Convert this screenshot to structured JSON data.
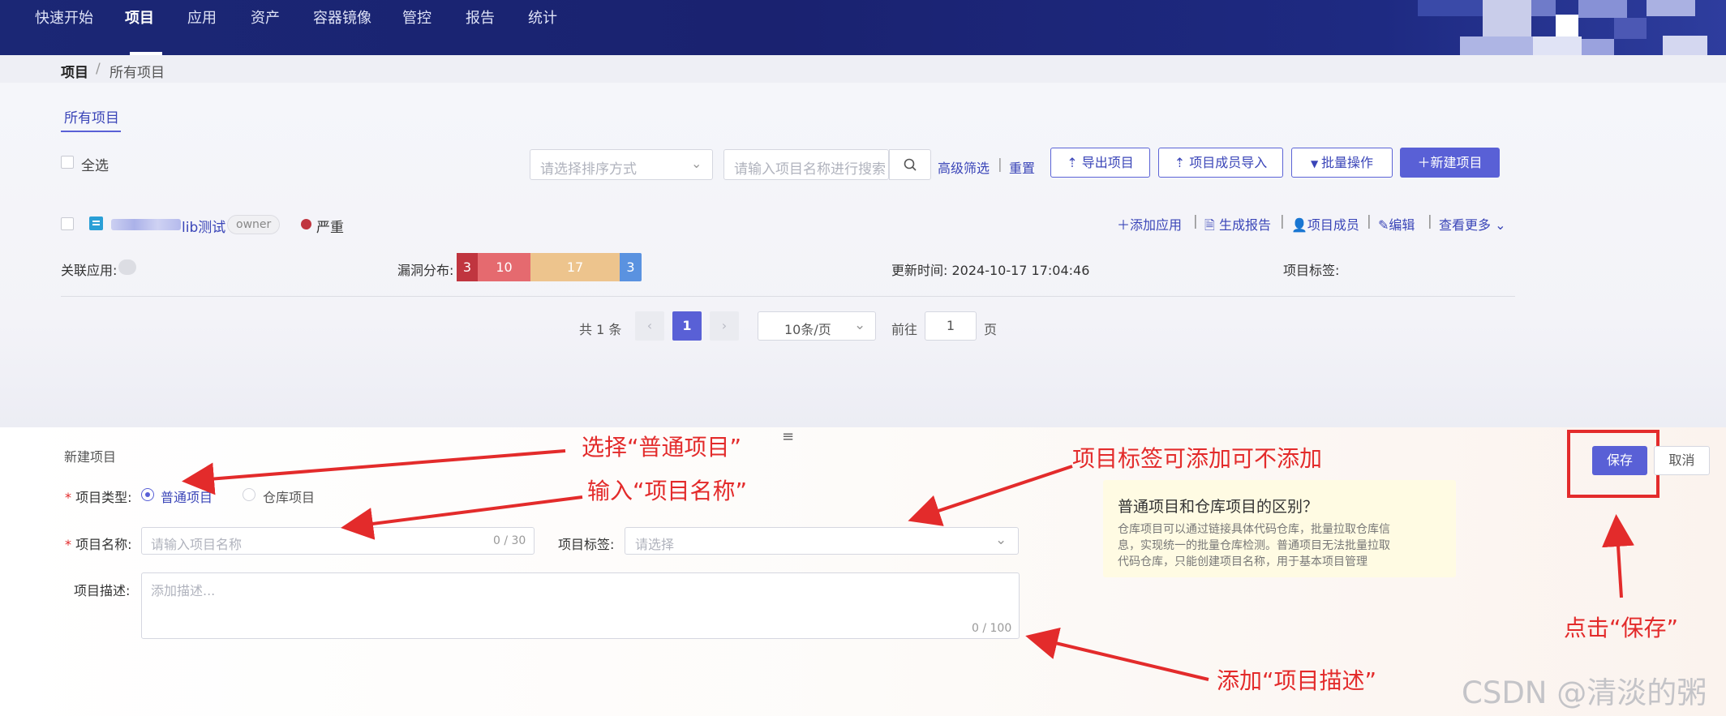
{
  "nav": {
    "items": [
      "快速开始",
      "项目",
      "应用",
      "资产",
      "容器镜像",
      "管控",
      "报告",
      "统计"
    ],
    "active": "项目"
  },
  "breadcrumb": {
    "root": "项目",
    "sep": "/",
    "current": "所有项目"
  },
  "tab": "所有项目",
  "toolbar": {
    "select_all": "全选",
    "sort_placeholder": "请选择排序方式",
    "search_placeholder": "请输入项目名称进行搜索",
    "advanced_filter": "高级筛选",
    "divider": "|",
    "reset": "重置",
    "export": "导出项目",
    "import_members": "项目成员导入",
    "batch": "批量操作",
    "new_project": "新建项目"
  },
  "project": {
    "name_suffix": "lib测试",
    "role": "owner",
    "severity": "严重",
    "actions": [
      "添加应用",
      "生成报告",
      "项目成员",
      "编辑",
      "查看更多"
    ],
    "action_sep": "|",
    "related_apps_label": "关联应用:",
    "vuln_label": "漏洞分布:",
    "vuln_counts": [
      {
        "level": "critical",
        "count": "3",
        "color": "#c0353f"
      },
      {
        "level": "high",
        "count": "10",
        "color": "#e56a6f"
      },
      {
        "level": "medium",
        "count": "17",
        "color": "#edc48d"
      },
      {
        "level": "low",
        "count": "3",
        "color": "#5a92e0"
      }
    ],
    "updated": "更新时间: 2024-10-17 17:04:46",
    "tags_label": "项目标签:"
  },
  "pagination": {
    "total": "共 1 条",
    "prev": "‹",
    "current": "1",
    "next": "›",
    "page_size": "10条/页",
    "goto_label": "前往",
    "goto_value": "1",
    "page_unit": "页"
  },
  "form": {
    "title": "新建项目",
    "menu_glyph": "≡",
    "required_mark": "*",
    "type_label": "项目类型:",
    "type_options": [
      "普通项目",
      "仓库项目"
    ],
    "type_selected": "普通项目",
    "name_label": "项目名称:",
    "name_placeholder": "请输入项目名称",
    "name_counter": "0 / 30",
    "tags_label": "项目标签:",
    "tags_placeholder": "请选择",
    "desc_label": "项目描述:",
    "desc_placeholder": "添加描述...",
    "desc_counter": "0 / 100",
    "save": "保存",
    "cancel": "取消"
  },
  "help": {
    "title": "普通项目和仓库项目的区别？",
    "body_lines": [
      "仓库项目可以通过链接具体代码仓库，批量拉取仓库信",
      "息，实现统一的批量仓库检测。普通项目无法批量拉取",
      "代码仓库，只能创建项目名称，用于基本项目管理"
    ]
  },
  "annotations": {
    "select_type": "选择“普通项目”",
    "enter_name": "输入“项目名称”",
    "tags_optional": "项目标签可添加可不添加",
    "add_desc": "添加“项目描述”",
    "click_save": "点击“保存”"
  },
  "watermark": "CSDN @清淡的粥",
  "colors": {
    "nav_bg": "#1b2775",
    "accent": "#5960d6",
    "link": "#3a45b8",
    "annotation": "#e32b2b",
    "severity": "#c0353f"
  }
}
